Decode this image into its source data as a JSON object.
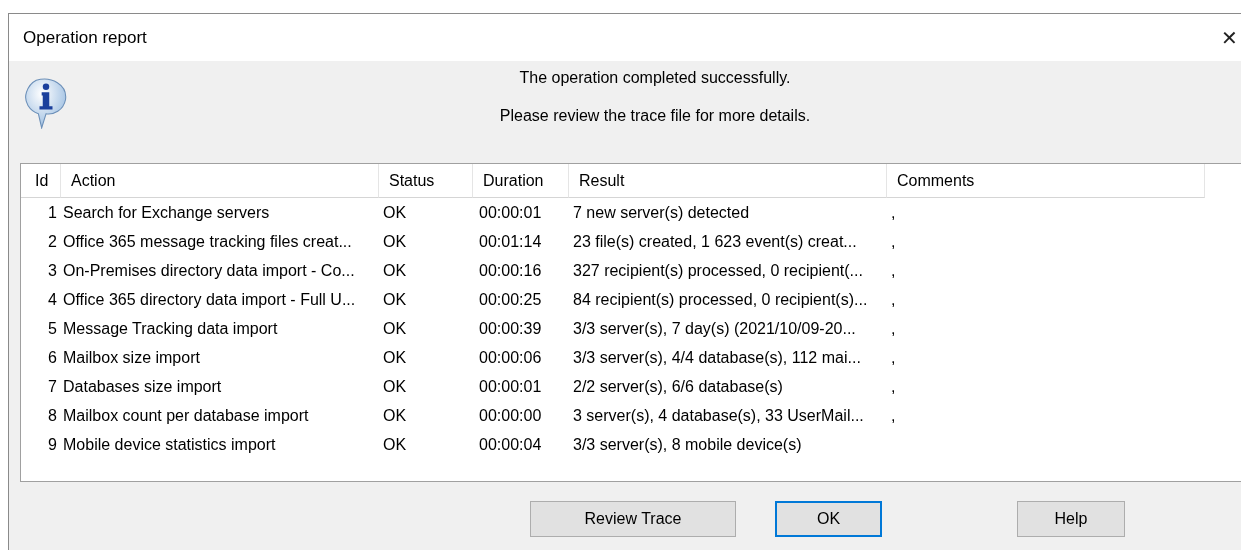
{
  "window": {
    "title": "Operation report",
    "close": "✕"
  },
  "messages": [
    "The operation completed successfully.",
    "Please review the trace file for more details."
  ],
  "table": {
    "columns": [
      "Id",
      "Action",
      "Status",
      "Duration",
      "Result",
      "Comments"
    ],
    "rows": [
      {
        "id": "1",
        "action": "Search for Exchange servers",
        "status": "OK",
        "duration": "00:00:01",
        "result": "7 new server(s) detected",
        "comments": ","
      },
      {
        "id": "2",
        "action": "Office 365 message tracking files creat...",
        "status": "OK",
        "duration": "00:01:14",
        "result": "23 file(s) created, 1 623 event(s) creat...",
        "comments": ","
      },
      {
        "id": "3",
        "action": "On-Premises directory data import - Co...",
        "status": "OK",
        "duration": "00:00:16",
        "result": "327 recipient(s) processed, 0 recipient(...",
        "comments": ","
      },
      {
        "id": "4",
        "action": "Office 365 directory data import - Full U...",
        "status": "OK",
        "duration": "00:00:25",
        "result": "84 recipient(s) processed, 0 recipient(s)...",
        "comments": ","
      },
      {
        "id": "5",
        "action": "Message Tracking data import",
        "status": "OK",
        "duration": "00:00:39",
        "result": "3/3 server(s), 7 day(s) (2021/10/09-20...",
        "comments": ","
      },
      {
        "id": "6",
        "action": "Mailbox size import",
        "status": "OK",
        "duration": "00:00:06",
        "result": "3/3 server(s), 4/4 database(s), 112 mai...",
        "comments": ","
      },
      {
        "id": "7",
        "action": "Databases size import",
        "status": "OK",
        "duration": "00:00:01",
        "result": "2/2 server(s), 6/6 database(s)",
        "comments": ","
      },
      {
        "id": "8",
        "action": "Mailbox count per database import",
        "status": "OK",
        "duration": "00:00:00",
        "result": "3 server(s), 4 database(s), 33 UserMail...",
        "comments": ","
      },
      {
        "id": "9",
        "action": "Mobile device statistics import",
        "status": "OK",
        "duration": "00:00:04",
        "result": "3/3 server(s), 8 mobile device(s)"
      }
    ]
  },
  "buttons": [
    {
      "label": "Review Trace",
      "focused": false
    },
    {
      "label": "OK",
      "focused": true
    },
    {
      "label": "Help",
      "focused": false
    }
  ]
}
